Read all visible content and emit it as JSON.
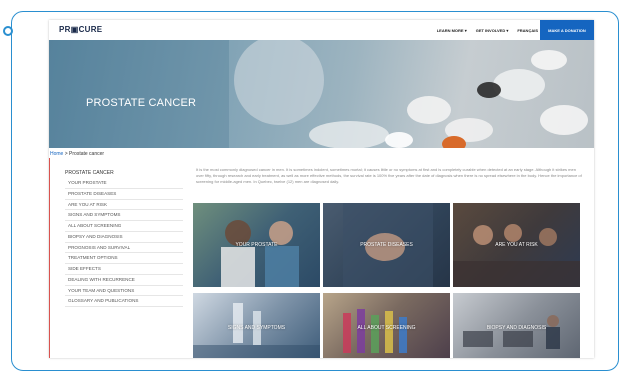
{
  "header": {
    "logo": "PR▣CURE",
    "nav": [
      "LEARN MORE ▾",
      "GET INVOLVED ▾",
      "FRANÇAIS"
    ],
    "donate": "MAKE A DONATION"
  },
  "hero": {
    "title": "PROSTATE CANCER"
  },
  "breadcrumb": {
    "home": "Home",
    "separator": " > ",
    "current": "Prostate cancer"
  },
  "sidebar": {
    "title": "PROSTATE CANCER",
    "items": [
      "YOUR PROSTATE",
      "PROSTATE DISEASES",
      "ARE YOU AT RISK",
      "SIGNS AND SYMPTOMS",
      "ALL ABOUT SCREENING",
      "BIOPSY AND DIAGNOSIS",
      "PROGNOSIS AND SURVIVAL",
      "TREATMENT OPTIONS",
      "SIDE EFFECTS",
      "DEALING WITH RECURRENCE",
      "YOUR TEAM AND QUESTIONS",
      "GLOSSARY AND PUBLICATIONS"
    ]
  },
  "intro": "It is the most commonly diagnosed cancer in men. It is sometimes indolent, sometimes mortal; it causes little or no symptoms at first and is completely curable when detected at an early stage. Although it strikes men over fifty, through research and early treatment, as well as more effective methods, the survival rate is 100% five years after the date of diagnosis when there is no spread elsewhere in the body. Hence the importance of screening for middle-aged men. In Quebec, twelve (12) men are diagnosed daily.",
  "tiles": [
    "YOUR PROSTATE",
    "PROSTATE DISEASES",
    "ARE YOU AT RISK",
    "SIGNS AND SYMPTOMS",
    "ALL ABOUT SCREENING",
    "BIOPSY AND DIAGNOSIS"
  ],
  "colors": {
    "frame": "#2a8fd0",
    "donate_bg": "#1565c0",
    "link": "#1565c0",
    "accent_line": "#d9534f"
  }
}
